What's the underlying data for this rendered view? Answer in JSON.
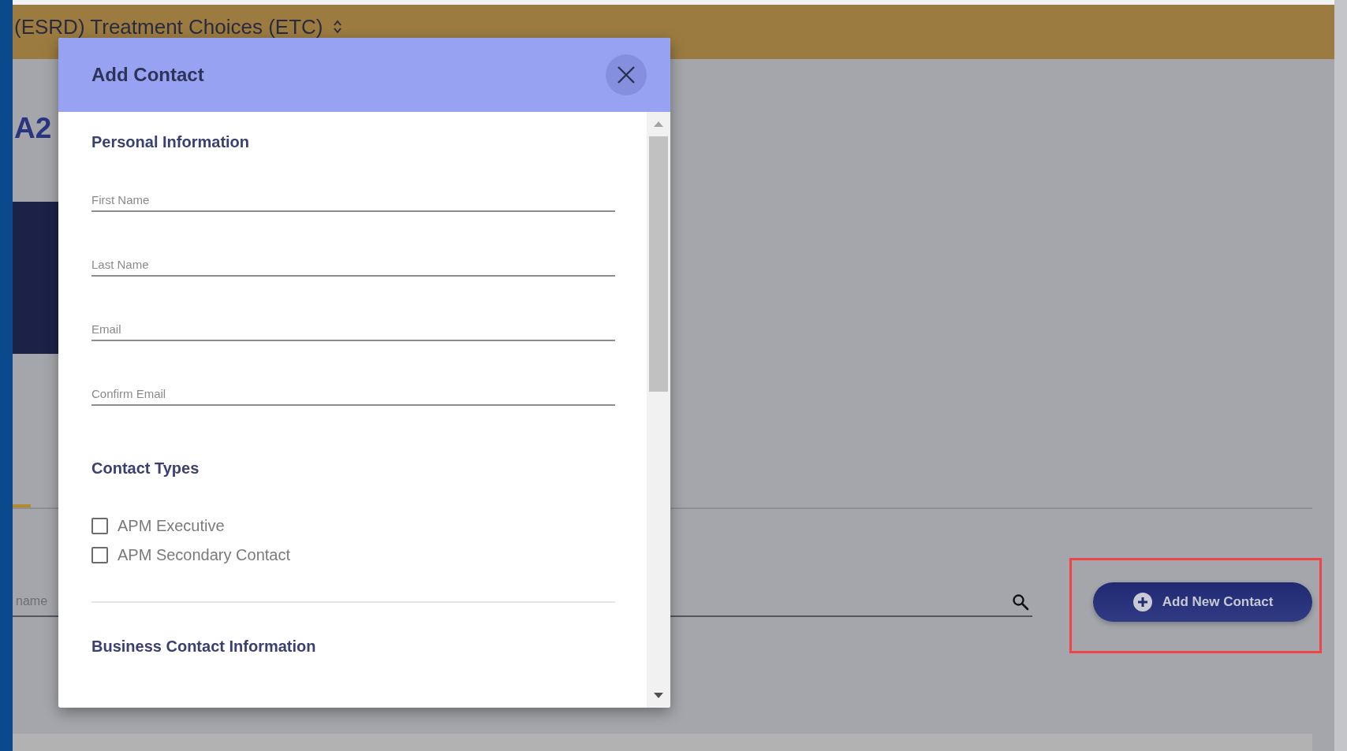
{
  "page": {
    "program_title": "(ESRD) Treatment Choices (ETC)",
    "heading": "A2",
    "search": {
      "placeholder": "name"
    },
    "add_button": "Add New Contact",
    "highlighted": true
  },
  "dialog": {
    "title": "Add Contact",
    "sections": [
      {
        "kind": "fields",
        "title": "Personal Information",
        "fields": [
          {
            "placeholder": "First Name"
          },
          {
            "placeholder": "Last Name"
          },
          {
            "placeholder": "Email"
          },
          {
            "placeholder": "Confirm Email"
          }
        ]
      },
      {
        "kind": "checkboxes",
        "title": "Contact Types",
        "options": [
          {
            "label": "APM Executive",
            "checked": false
          },
          {
            "label": "APM Secondary Contact",
            "checked": false
          }
        ]
      },
      {
        "kind": "heading",
        "title": "Business Contact Information"
      }
    ]
  }
}
